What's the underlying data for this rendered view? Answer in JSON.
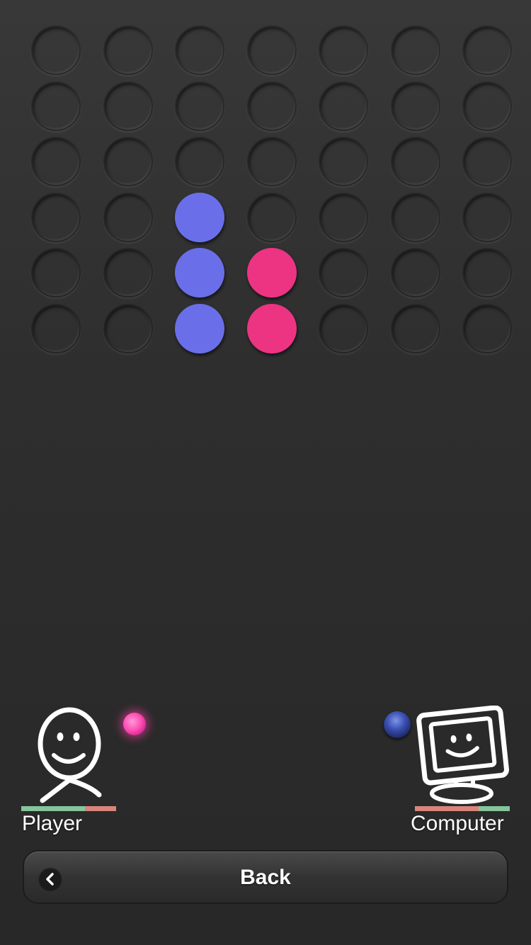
{
  "board": {
    "columns": 7,
    "rows": 6,
    "grid": [
      [
        "empty",
        "empty",
        "empty",
        "empty",
        "empty",
        "empty",
        "empty"
      ],
      [
        "empty",
        "empty",
        "empty",
        "empty",
        "empty",
        "empty",
        "empty"
      ],
      [
        "empty",
        "empty",
        "empty",
        "empty",
        "empty",
        "empty",
        "empty"
      ],
      [
        "empty",
        "empty",
        "blue",
        "empty",
        "empty",
        "empty",
        "empty"
      ],
      [
        "empty",
        "empty",
        "blue",
        "pink",
        "empty",
        "empty",
        "empty"
      ],
      [
        "empty",
        "empty",
        "blue",
        "pink",
        "empty",
        "empty",
        "empty"
      ]
    ]
  },
  "colors": {
    "blue_disc": "#6a6fe9",
    "pink_disc": "#ec3483",
    "bar_green": "#86c59d",
    "bar_red": "#d9857c"
  },
  "player": {
    "name": "Player",
    "icon": "smiley-person-icon",
    "token": "pink-glow-token"
  },
  "computer": {
    "name": "Computer",
    "icon": "computer-monitor-icon",
    "token": "blue-glass-token"
  },
  "back": {
    "label": "Back",
    "icon": "chevron-left-icon"
  }
}
